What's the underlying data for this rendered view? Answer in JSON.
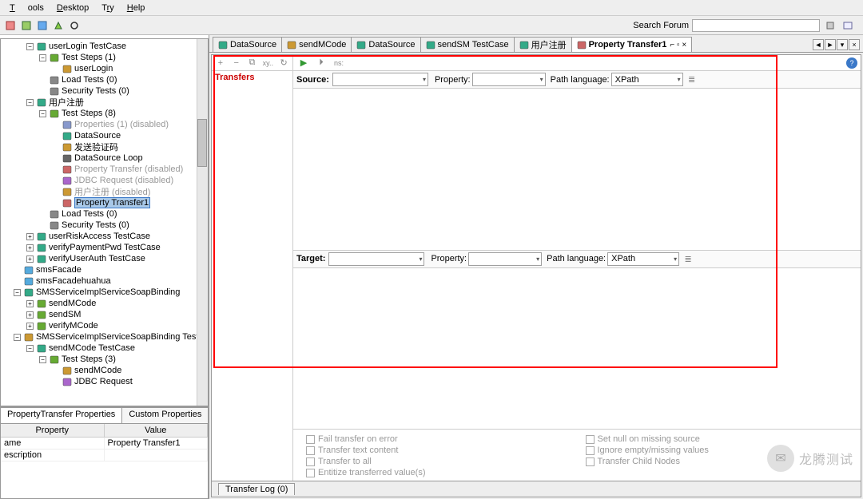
{
  "menu": {
    "tools": "Tools",
    "desktop": "Desktop",
    "try": "Try",
    "help": "Help"
  },
  "search": {
    "label": "Search Forum"
  },
  "tree": [
    {
      "d": 1,
      "t": "-",
      "ic": "testcase",
      "lbl": "userLogin TestCase"
    },
    {
      "d": 2,
      "t": "-",
      "ic": "steps",
      "lbl": "Test Steps (1)"
    },
    {
      "d": 3,
      "t": "",
      "ic": "req",
      "lbl": "userLogin"
    },
    {
      "d": 2,
      "t": "",
      "ic": "load",
      "lbl": "Load Tests (0)"
    },
    {
      "d": 2,
      "t": "",
      "ic": "sec",
      "lbl": "Security Tests (0)"
    },
    {
      "d": 1,
      "t": "-",
      "ic": "testcase",
      "lbl": "用户注册"
    },
    {
      "d": 2,
      "t": "-",
      "ic": "steps",
      "lbl": "Test Steps (8)"
    },
    {
      "d": 3,
      "t": "",
      "ic": "prop",
      "lbl": "Properties (1) (disabled)",
      "dis": true
    },
    {
      "d": 3,
      "t": "",
      "ic": "ds",
      "lbl": "DataSource"
    },
    {
      "d": 3,
      "t": "",
      "ic": "req",
      "lbl": "发送验证码"
    },
    {
      "d": 3,
      "t": "",
      "ic": "loop",
      "lbl": "DataSource Loop"
    },
    {
      "d": 3,
      "t": "",
      "ic": "pt",
      "lbl": "Property Transfer (disabled)",
      "dis": true
    },
    {
      "d": 3,
      "t": "",
      "ic": "jdbc",
      "lbl": "JDBC Request (disabled)",
      "dis": true
    },
    {
      "d": 3,
      "t": "",
      "ic": "req",
      "lbl": "用户注册 (disabled)",
      "dis": true
    },
    {
      "d": 3,
      "t": "",
      "ic": "pt",
      "lbl": "Property Transfer1",
      "sel": true
    },
    {
      "d": 2,
      "t": "",
      "ic": "load",
      "lbl": "Load Tests (0)"
    },
    {
      "d": 2,
      "t": "",
      "ic": "sec",
      "lbl": "Security Tests (0)"
    },
    {
      "d": 1,
      "t": "+",
      "ic": "testcase",
      "lbl": "userRiskAccess TestCase"
    },
    {
      "d": 1,
      "t": "+",
      "ic": "testcase",
      "lbl": "verifyPaymentPwd TestCase"
    },
    {
      "d": 1,
      "t": "+",
      "ic": "testcase",
      "lbl": "verifyUserAuth TestCase"
    },
    {
      "d": 0,
      "t": "",
      "ic": "svc",
      "lbl": "smsFacade"
    },
    {
      "d": 0,
      "t": "",
      "ic": "svc",
      "lbl": "smsFacadehuahua"
    },
    {
      "d": 0,
      "t": "-",
      "ic": "iface",
      "lbl": "SMSServiceImplServiceSoapBinding"
    },
    {
      "d": 1,
      "t": "+",
      "ic": "op",
      "lbl": "sendMCode"
    },
    {
      "d": 1,
      "t": "+",
      "ic": "op",
      "lbl": "sendSM"
    },
    {
      "d": 1,
      "t": "+",
      "ic": "op",
      "lbl": "verifyMCode"
    },
    {
      "d": 0,
      "t": "-",
      "ic": "suite",
      "lbl": "SMSServiceImplServiceSoapBinding TestSuit"
    },
    {
      "d": 1,
      "t": "-",
      "ic": "testcase",
      "lbl": "sendMCode TestCase"
    },
    {
      "d": 2,
      "t": "-",
      "ic": "steps",
      "lbl": "Test Steps (3)"
    },
    {
      "d": 3,
      "t": "",
      "ic": "req",
      "lbl": "sendMCode"
    },
    {
      "d": 3,
      "t": "",
      "ic": "jdbc",
      "lbl": "JDBC Request"
    }
  ],
  "propTabs": {
    "a": "PropertyTransfer Properties",
    "b": "Custom Properties"
  },
  "propGrid": {
    "h1": "Property",
    "h2": "Value",
    "rows": [
      {
        "k": "ame",
        "v": "Property Transfer1"
      },
      {
        "k": "escription",
        "v": ""
      }
    ]
  },
  "edTabs": [
    {
      "ic": "ds",
      "lbl": "DataSource"
    },
    {
      "ic": "req",
      "lbl": "sendMCode"
    },
    {
      "ic": "ds",
      "lbl": "DataSource"
    },
    {
      "ic": "tc",
      "lbl": "sendSM TestCase"
    },
    {
      "ic": "tc",
      "lbl": "用户注册"
    },
    {
      "ic": "pt",
      "lbl": "Property Transfer1",
      "active": true
    }
  ],
  "editor": {
    "transfers": "Transfers",
    "source": "Source:",
    "target": "Target:",
    "property": "Property:",
    "pathlang": "Path language:",
    "xpath": "XPath",
    "opts": {
      "a1": "Fail transfer on error",
      "a2": "Transfer text content",
      "a3": "Transfer to all",
      "a4": "Entitize transferred value(s)",
      "b1": "Set null on missing source",
      "b2": "Ignore empty/missing values",
      "b3": "Transfer Child Nodes"
    },
    "log": "Transfer Log (0)"
  },
  "watermark": "龙腾测试"
}
